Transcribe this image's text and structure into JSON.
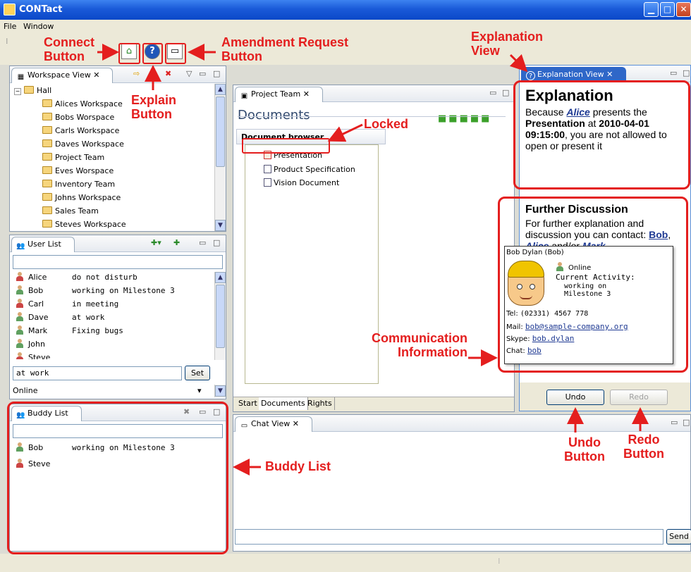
{
  "window": {
    "title": "CONTact"
  },
  "menu": {
    "items": [
      "File",
      "Window"
    ]
  },
  "workspace_view": {
    "tab_label": "Workspace View",
    "root": "Hall",
    "items": [
      "Alices Workspace",
      "Bobs Worspace",
      "Carls Workspace",
      "Daves Workspace",
      "Project Team",
      "Eves Worspace",
      "Inventory Team",
      "Johns Workspace",
      "Sales Team",
      "Steves Workspace"
    ]
  },
  "user_list": {
    "tab_label": "User List",
    "users": [
      {
        "name": "Alice",
        "status": "do not disturb",
        "state": "red"
      },
      {
        "name": "Bob",
        "status": "working on Milestone 3",
        "state": "green"
      },
      {
        "name": "Carl",
        "status": "in meeting",
        "state": "red"
      },
      {
        "name": "Dave",
        "status": "at work",
        "state": "green"
      },
      {
        "name": "Mark",
        "status": "Fixing bugs",
        "state": "green"
      },
      {
        "name": "John",
        "status": "",
        "state": "green"
      },
      {
        "name": "Steve",
        "status": "",
        "state": "red"
      }
    ],
    "status_input": "at work",
    "set_button": "Set",
    "presence": "Online"
  },
  "buddy_list": {
    "tab_label": "Buddy List",
    "buddies": [
      {
        "name": "Bob",
        "status": "working on Milestone 3",
        "state": "green"
      },
      {
        "name": "Steve",
        "status": "",
        "state": "red"
      }
    ]
  },
  "project_team": {
    "tab_label": "Project Team",
    "heading": "Documents",
    "browser_label": "Document browser",
    "documents": [
      "Presentation",
      "Product Specification",
      "Vision Document"
    ],
    "bottom_tabs": [
      "Start",
      "Documents",
      "Rights"
    ]
  },
  "chat_view": {
    "tab_label": "Chat View",
    "send_button": "Send"
  },
  "explanation_view": {
    "tab_label": "Explanation View",
    "title": "Explanation",
    "body": {
      "t1": "Because ",
      "who": "Alice",
      "t2": " presents the ",
      "what": "Presentation",
      "t3": " at ",
      "when": "2010-04-01 09:15:00",
      "t4": ", you are not allowed to open or present it"
    },
    "further_title": "Further Discussion",
    "further_text": "For further explanation and discussion you can contact:",
    "contacts": [
      "Bob",
      "Alice",
      "Mark"
    ],
    "contact_sep1": ", ",
    "contact_sep2": " and/or ",
    "contact_end": ".",
    "card": {
      "name": "Bob Dylan (Bob)",
      "presence": "Online",
      "activity_label": "Current Activity:",
      "activity": "working on Milestone 3",
      "tel_label": "Tel:",
      "tel": "(02331) 4567 778",
      "mail_label": "Mail:",
      "mail": "bob@sample-company.org",
      "skype_label": "Skype:",
      "skype": "bob.dylan",
      "chat_label": "Chat:",
      "chat": "bob"
    },
    "undo_button": "Undo",
    "redo_button": "Redo"
  },
  "annotations": {
    "connect_button": "Connect\nButton",
    "explain_button": "Explain\nButton",
    "amendment_button": "Amendment Request\nButton",
    "explanation_view": "Explanation\nView",
    "locked": "Locked",
    "communication_info": "Communication\nInformation",
    "buddy_list": "Buddy List",
    "undo_button": "Undo\nButton",
    "redo_button": "Redo\nButton"
  },
  "colors": {
    "annotation_red": "#e41e1e",
    "titlebar_blue": "#1a5ad8",
    "link_blue": "#1f3a93"
  }
}
